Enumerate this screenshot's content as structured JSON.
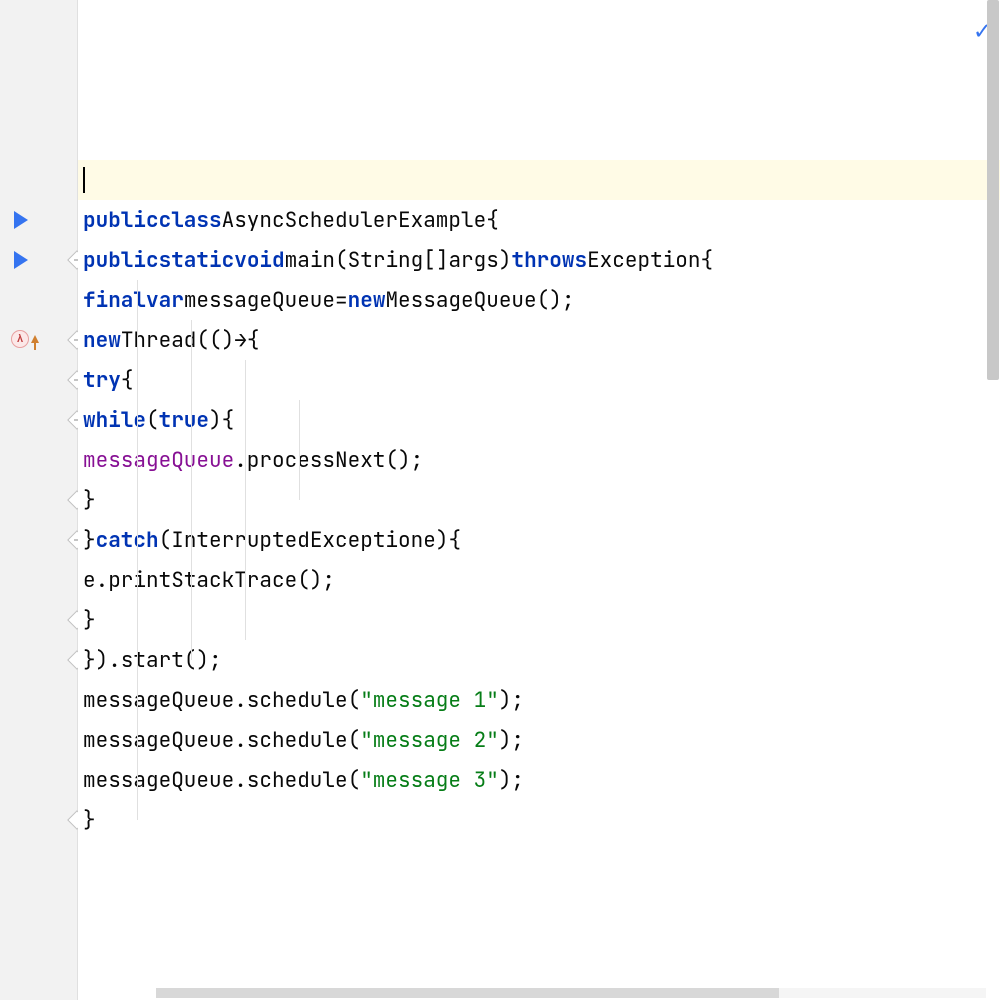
{
  "status": {
    "no_problems": "✓"
  },
  "code": {
    "tokens": {
      "public": "public",
      "class": "class",
      "classname": "AsyncSchedulerExample",
      "obrace": "{",
      "cbrace": "}",
      "static": "static",
      "void": "void",
      "main": "main",
      "lparen": "(",
      "rparen": ")",
      "string_arr": "String[]",
      "args": "args",
      "throws": "throws",
      "exception": "Exception",
      "final": "final",
      "var": "var",
      "mq_name": "messageQueue",
      "eq": "=",
      "new": "new",
      "mq_type": "MessageQueue",
      "empty_parens": "()",
      "semi": ";",
      "thread": "Thread",
      "lambda_open": "((",
      "arrow": "→",
      "try": "try",
      "while": "while",
      "true": "true",
      "process_next": ".processNext();",
      "catch": "catch",
      "ie": "InterruptedException",
      "e": "e",
      "print_stack": "e.printStackTrace();",
      "close_start": "}).start();",
      "schedule": ".schedule(",
      "msg1": "\"message 1\"",
      "msg2": "\"message 2\"",
      "msg3": "\"message 3\"",
      "close_call": ");"
    }
  },
  "lambda_glyph": "λ"
}
